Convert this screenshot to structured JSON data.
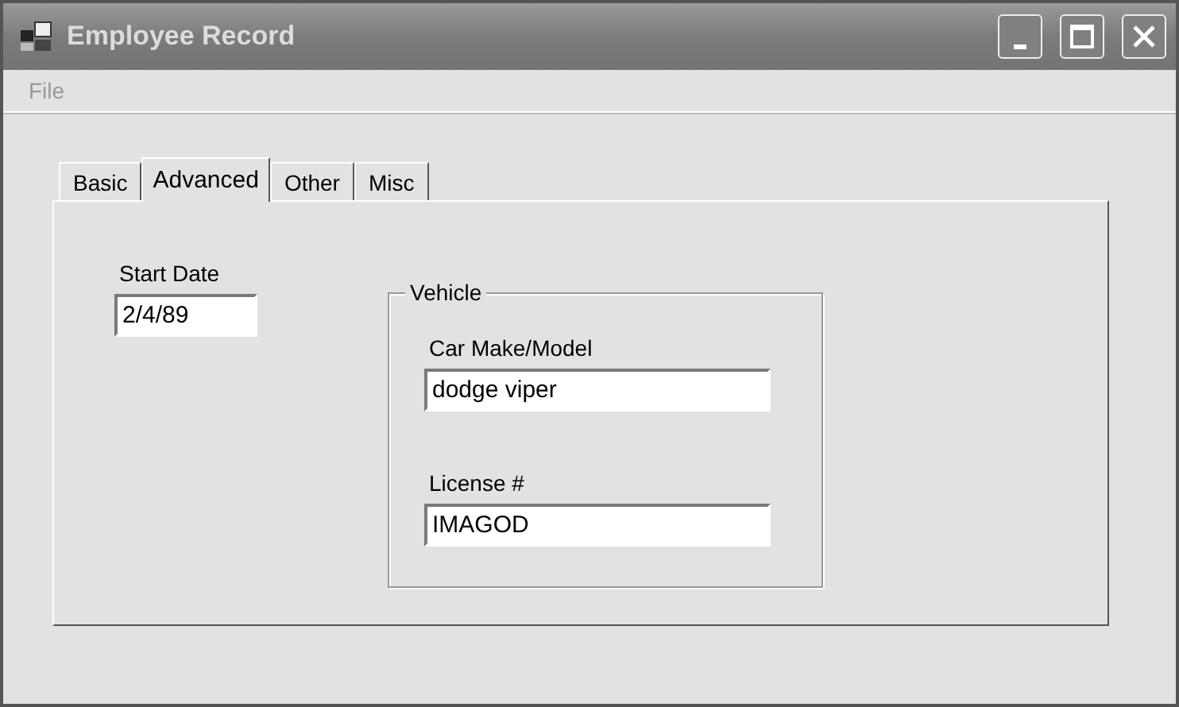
{
  "window": {
    "title": "Employee Record"
  },
  "menu": [
    {
      "label": "File"
    }
  ],
  "tabs": [
    {
      "label": "Basic",
      "selected": false
    },
    {
      "label": "Advanced",
      "selected": true
    },
    {
      "label": "Other",
      "selected": false
    },
    {
      "label": "Misc",
      "selected": false
    }
  ],
  "start_date": {
    "label": "Start Date",
    "value": "2/4/89"
  },
  "vehicle": {
    "title": "Vehicle",
    "fields": [
      {
        "label": "Car Make/Model",
        "value": "dodge viper"
      },
      {
        "label": "License #",
        "value": "IMAGOD"
      }
    ]
  }
}
